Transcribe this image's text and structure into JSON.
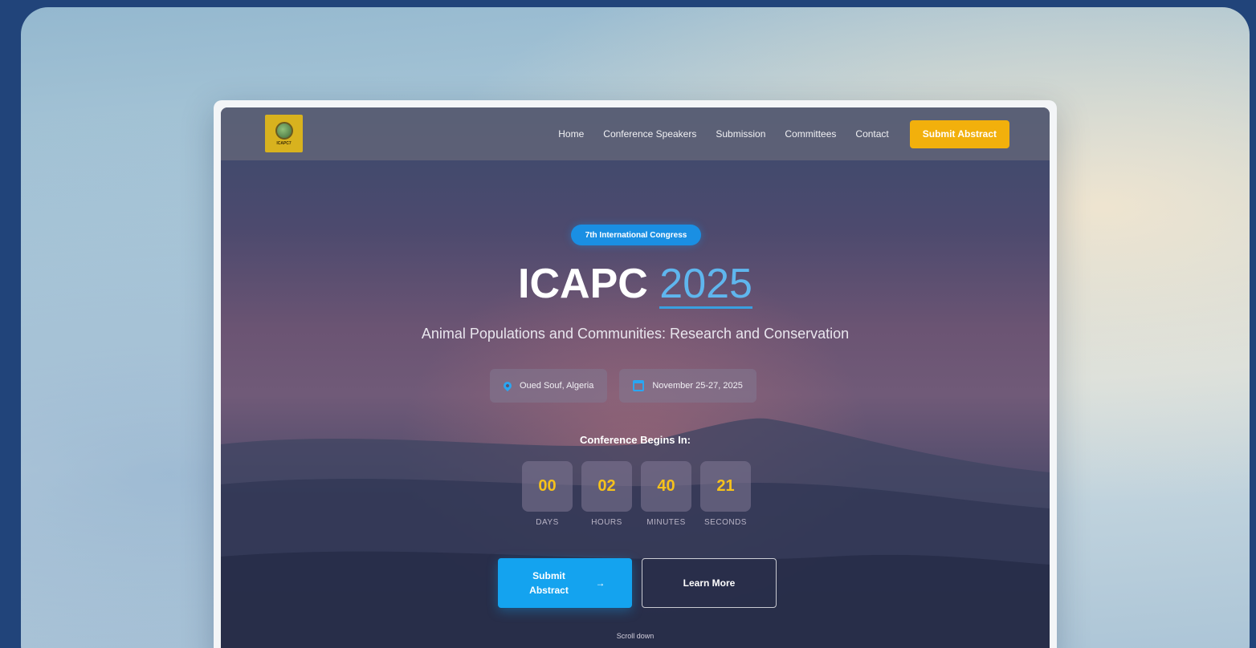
{
  "nav": {
    "logo_text": "ICAPC7",
    "links": [
      "Home",
      "Conference Speakers",
      "Submission",
      "Committees",
      "Contact"
    ],
    "cta": "Submit Abstract"
  },
  "hero": {
    "badge": "7th International Congress",
    "title_main": "ICAPC",
    "title_year": "2025",
    "subtitle": "Animal Populations and Communities: Research and Conservation",
    "location": "Oued Souf, Algeria",
    "dates": "November 25-27, 2025",
    "countdown_heading": "Conference Begins In:",
    "countdown": [
      {
        "value": "00",
        "label": "DAYS"
      },
      {
        "value": "02",
        "label": "HOURS"
      },
      {
        "value": "40",
        "label": "MINUTES"
      },
      {
        "value": "21",
        "label": "SECONDS"
      }
    ],
    "primary_button": "Submit Abstract",
    "primary_arrow": "→",
    "secondary_button": "Learn More",
    "scroll_hint": "Scroll down"
  },
  "colors": {
    "accent": "#14a3ef",
    "cta": "#f2b00c",
    "countdown_digits": "#f6c21b",
    "outer_background": "#21447a"
  }
}
